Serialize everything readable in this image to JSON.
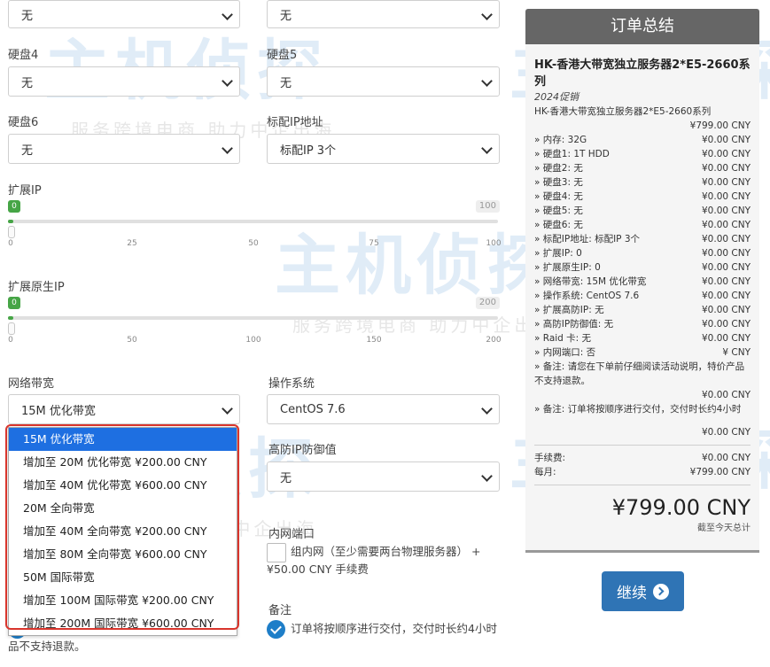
{
  "form": {
    "top_left_select": "无",
    "top_right_select": "无",
    "disk4": {
      "label": "硬盘4",
      "value": "无"
    },
    "disk5": {
      "label": "硬盘5",
      "value": "无"
    },
    "disk6": {
      "label": "硬盘6",
      "value": "无"
    },
    "standard_ip": {
      "label": "标配IP地址",
      "value": "标配IP 3个"
    },
    "extra_ip": {
      "label": "扩展IP",
      "current": "0",
      "max": "100",
      "value_fraction": 0.0,
      "ticks": [
        "0",
        "25",
        "50",
        "75",
        "100"
      ]
    },
    "extra_native_ip": {
      "label": "扩展原生IP",
      "current": "0",
      "max": "200",
      "value_fraction": 0.0,
      "ticks": [
        "0",
        "50",
        "100",
        "150",
        "200"
      ]
    },
    "bandwidth": {
      "label": "网络带宽",
      "value": "15M 优化带宽",
      "options": [
        "15M 优化带宽",
        "增加至 20M 优化带宽 ¥200.00 CNY",
        "增加至 40M 优化带宽 ¥600.00 CNY",
        "20M 全向带宽",
        "增加至 40M 全向带宽 ¥200.00 CNY",
        "增加至 80M 全向带宽 ¥600.00 CNY",
        "50M 国际带宽",
        "增加至 100M 国际带宽 ¥200.00 CNY",
        "增加至 200M 国际带宽 ¥600.00 CNY"
      ],
      "selected_index": 0
    },
    "os": {
      "label": "操作系统",
      "value": "CentOS 7.6"
    },
    "ddos": {
      "label": "高防IP防御值",
      "value": "无"
    },
    "internal_port": {
      "label": "内网端口",
      "option_text": "组内网（至少需要两台物理服务器） + ¥50.00 CNY 手续费"
    },
    "remark": {
      "label": "备注",
      "option_text": "订单将按顺序进行交付，交付时长约4小时"
    },
    "left_remark_fragment": "品不支持退款。"
  },
  "summary": {
    "header": "订单总结",
    "product_title": "HK-香港大带宽独立服务器2*E5-2660系列",
    "product_sub": "2024促销",
    "product_line": "HK-香港大带宽独立服务器2*E5-2660系列",
    "product_price": "¥799.00 CNY",
    "rows": [
      {
        "label": "» 内存: 32G",
        "price": "¥0.00 CNY"
      },
      {
        "label": "» 硬盘1: 1T HDD",
        "price": "¥0.00 CNY"
      },
      {
        "label": "» 硬盘2: 无",
        "price": "¥0.00 CNY"
      },
      {
        "label": "» 硬盘3: 无",
        "price": "¥0.00 CNY"
      },
      {
        "label": "» 硬盘4: 无",
        "price": "¥0.00 CNY"
      },
      {
        "label": "» 硬盘5: 无",
        "price": "¥0.00 CNY"
      },
      {
        "label": "» 硬盘6: 无",
        "price": "¥0.00 CNY"
      },
      {
        "label": "» 标配IP地址: 标配IP 3个",
        "price": "¥0.00 CNY"
      },
      {
        "label": "» 扩展IP: 0",
        "price": "¥0.00 CNY"
      },
      {
        "label": "» 扩展原生IP: 0",
        "price": "¥0.00 CNY"
      },
      {
        "label": "» 网络带宽: 15M 优化带宽",
        "price": "¥0.00 CNY"
      },
      {
        "label": "» 操作系统: CentOS 7.6",
        "price": "¥0.00 CNY"
      },
      {
        "label": "» 扩展高防IP: 无",
        "price": "¥0.00 CNY"
      },
      {
        "label": "» 高防IP防御值: 无",
        "price": "¥0.00 CNY"
      },
      {
        "label": "» Raid 卡: 无",
        "price": "¥0.00 CNY"
      },
      {
        "label": "» 内网端口: 否",
        "price": "¥ CNY"
      }
    ],
    "note1": "» 备注: 请您在下单前仔细阅读活动说明，特价产品不支持退款。",
    "note1_price": "¥0.00 CNY",
    "note2": "» 备注: 订单将按顺序进行交付，交付时长约4小时",
    "note2_price": "¥0.00 CNY",
    "fee_label": "手续费:",
    "fee_value": "¥0.00 CNY",
    "monthly_label": "每月:",
    "monthly_value": "¥799.00 CNY",
    "total": "¥799.00 CNY",
    "total_note": "截至今天总计"
  },
  "continue_button": "继续",
  "watermark": {
    "brand": "主机侦探",
    "slogan": "服务跨境电商 助力中企出海"
  },
  "colors": {
    "accent": "#2f74b5",
    "slider": "#46a546",
    "highlight": "#d9352c",
    "selected_option": "#1e6fe1"
  }
}
